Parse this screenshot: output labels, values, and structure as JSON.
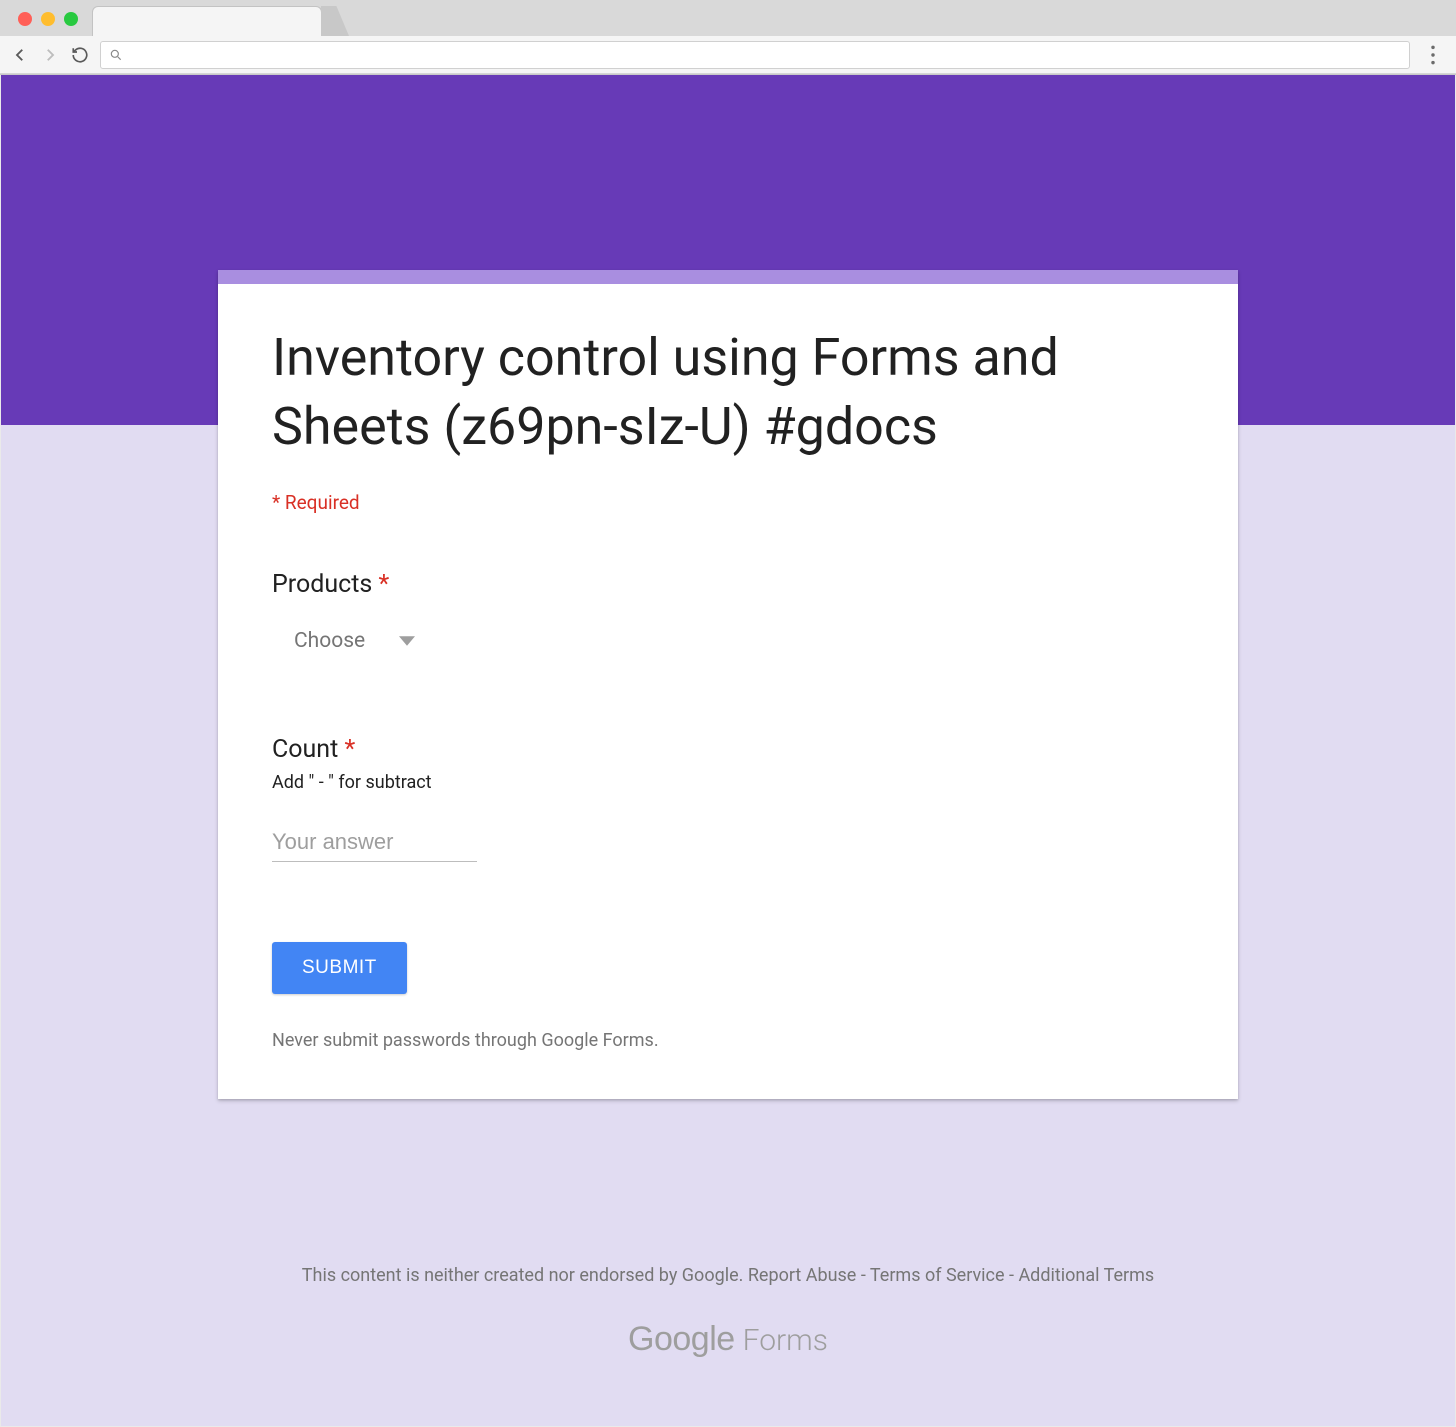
{
  "browser": {
    "url": ""
  },
  "form": {
    "title": "Inventory control using Forms and Sheets (z69pn-sIz-U) #gdocs",
    "required_note": "* Required",
    "questions": {
      "products": {
        "label": "Products",
        "required_marker": "*",
        "dropdown_placeholder": "Choose"
      },
      "count": {
        "label": "Count",
        "required_marker": "*",
        "help": "Add \" - \" for subtract",
        "placeholder": "Your answer",
        "value": ""
      }
    },
    "submit_label": "SUBMIT",
    "password_warning": "Never submit passwords through Google Forms."
  },
  "footer": {
    "disclaimer_prefix": "This content is neither created nor endorsed by Google. ",
    "report_abuse": "Report Abuse",
    "sep1": " - ",
    "tos": "Terms of Service",
    "sep2": " - ",
    "additional": "Additional Terms",
    "logo_google": "Google",
    "logo_forms": "Forms"
  },
  "colors": {
    "brand": "#673ab7",
    "accent_light": "#a98ee0",
    "page_bg": "#e1dcf2",
    "required": "#d93025",
    "submit": "#4285f4"
  }
}
